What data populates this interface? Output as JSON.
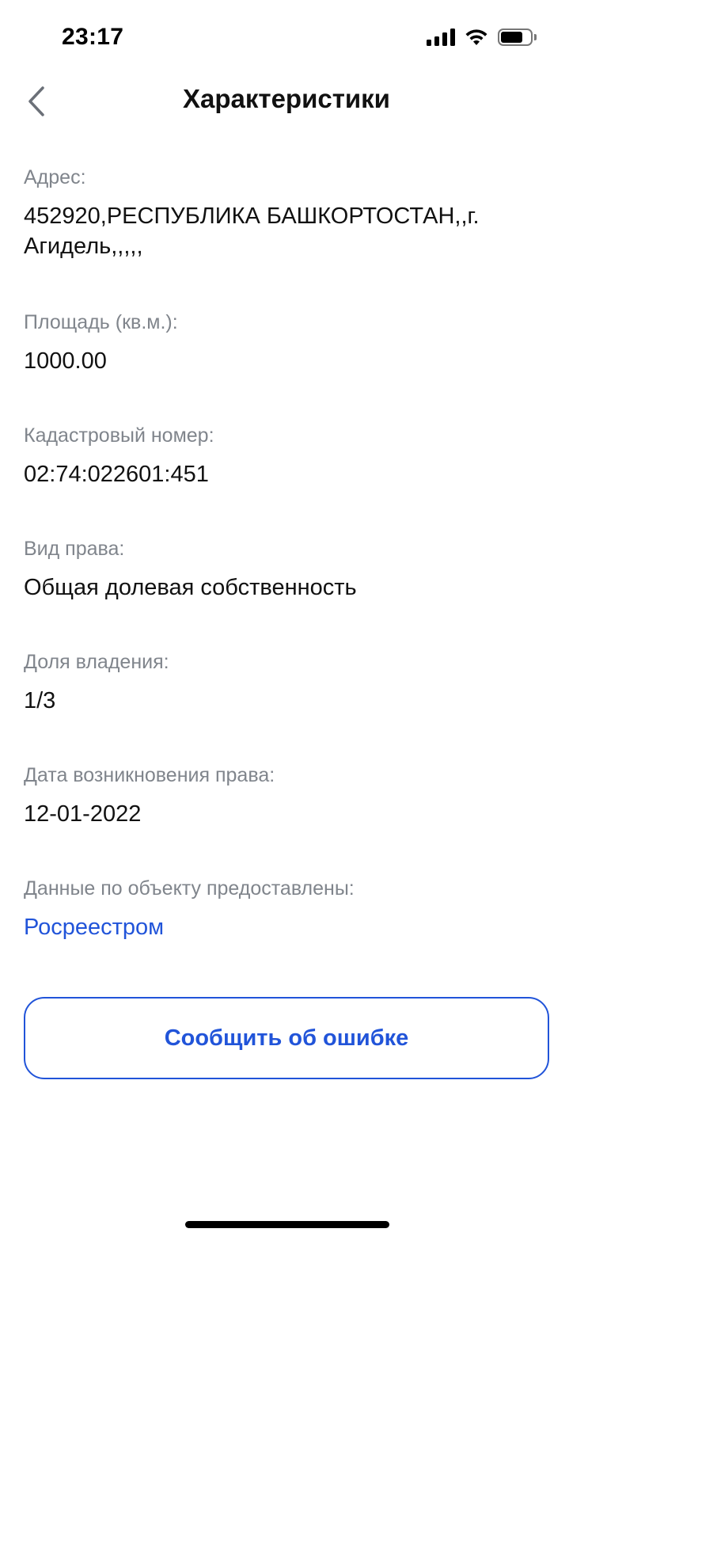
{
  "status_bar": {
    "time": "23:17"
  },
  "header": {
    "title": "Характеристики",
    "back_icon": "chevron-left-icon"
  },
  "fields": {
    "address": {
      "label": "Адрес:",
      "value": "452920,РЕСПУБЛИКА БАШКОРТОСТАН,,г. Агидель,,,,,"
    },
    "area": {
      "label": "Площадь (кв.м.):",
      "value": "1000.00"
    },
    "cadastral": {
      "label": "Кадастровый номер:",
      "value": "02:74:022601:451"
    },
    "right_type": {
      "label": "Вид права:",
      "value": "Общая долевая собственность"
    },
    "share": {
      "label": "Доля владения:",
      "value": "1/3"
    },
    "right_date": {
      "label": "Дата возникновения права:",
      "value": "12-01-2022"
    },
    "source": {
      "label": "Данные по объекту предоставлены:",
      "value": "Росреестром"
    }
  },
  "actions": {
    "report_label": "Сообщить об ошибке"
  },
  "colors": {
    "accent": "#2154d9",
    "label": "#80858c",
    "text": "#111111"
  }
}
